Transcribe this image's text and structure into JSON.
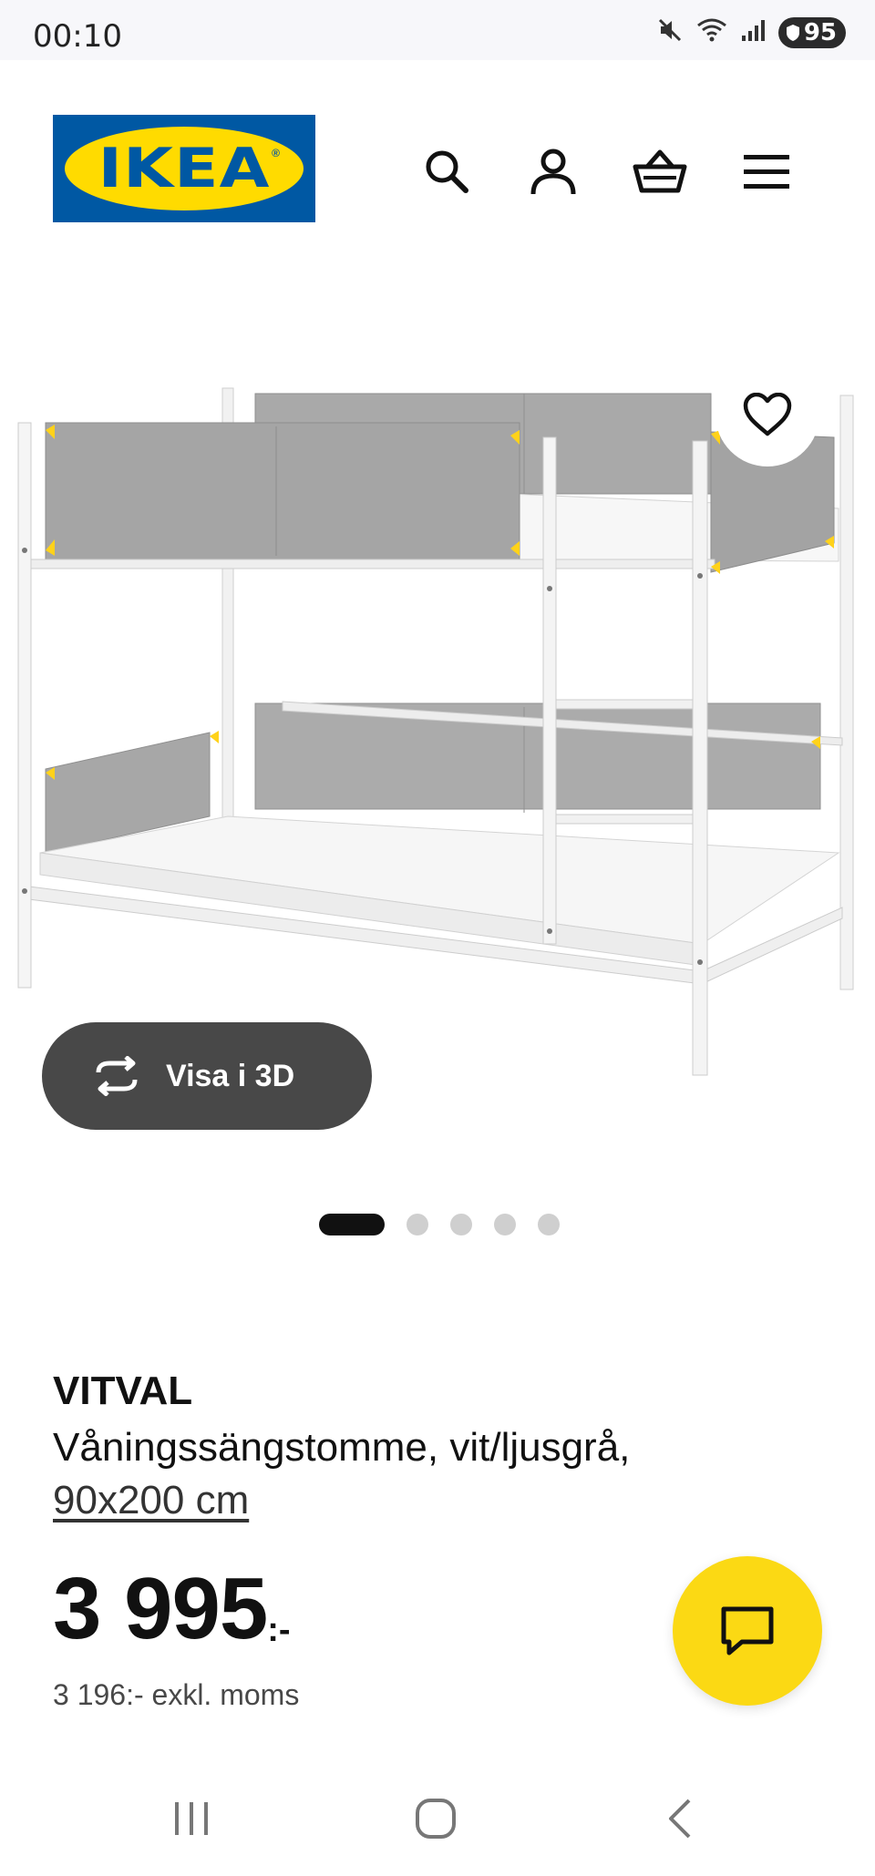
{
  "status_bar": {
    "time": "00:10",
    "battery": "95",
    "icons": [
      "mute-icon",
      "wifi-icon",
      "signal-icon",
      "battery-icon"
    ]
  },
  "header": {
    "logo_text": "IKEA",
    "icons": [
      "search-icon",
      "account-icon",
      "cart-icon",
      "menu-icon"
    ],
    "brand_colors": {
      "blue": "#0058a3",
      "yellow": "#ffdb00"
    }
  },
  "gallery": {
    "view_3d_label": "Visa i 3D",
    "slide_count": 5,
    "active_slide": 1
  },
  "product": {
    "name": "VITVAL",
    "description": "Våningssängstomme, vit/ljusgrå,",
    "size": "90x200 cm",
    "price": "3 995",
    "price_suffix": ":-",
    "price_excl_vat": "3 196:- exkl. moms"
  },
  "chat": {
    "color": "#fbd914"
  },
  "nav_bar": {
    "buttons": [
      "recent-apps-icon",
      "home-icon",
      "back-icon"
    ]
  }
}
